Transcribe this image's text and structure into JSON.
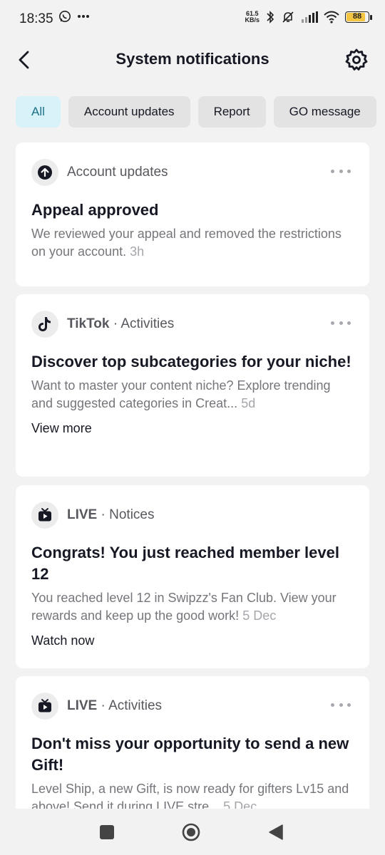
{
  "status_bar": {
    "time": "18:35",
    "net_speed_value": "61.5",
    "net_speed_unit": "KB/s",
    "battery": "88",
    "battery_level_percent": 88,
    "battery_color": "#f4c542",
    "icons": [
      "whatsapp-icon",
      "more-dots-icon",
      "bluetooth-icon",
      "mute-icon",
      "signal-icon",
      "wifi-icon",
      "battery-icon"
    ]
  },
  "header": {
    "title": "System notifications",
    "back_icon": "back-arrow-icon",
    "settings_icon": "gear-icon"
  },
  "filters": [
    {
      "label": "All",
      "active": true
    },
    {
      "label": "Account updates",
      "active": false
    },
    {
      "label": "Report",
      "active": false
    },
    {
      "label": "GO message",
      "active": false
    }
  ],
  "notifications": [
    {
      "icon": "upload-arrow-icon",
      "source": "Account updates",
      "category": "",
      "title": "Appeal approved",
      "body": "We reviewed your appeal and removed the restrictions on your account.",
      "time": "3h",
      "link": ""
    },
    {
      "icon": "tiktok-icon",
      "source": "TikTok",
      "category": "Activities",
      "title": "Discover top subcategories for your niche!",
      "body": "Want to master your content niche? Explore trending and suggested categories in Creat...",
      "time": "5d",
      "link": "View more"
    },
    {
      "icon": "live-tv-icon",
      "source": "LIVE",
      "category": "Notices",
      "title": "Congrats! You just reached member level 12",
      "body": "You reached level 12 in Swipzz's Fan Club. View your rewards and keep up the good work!",
      "time": "5 Dec",
      "link": "Watch now"
    },
    {
      "icon": "live-tv-icon",
      "source": "LIVE",
      "category": "Activities",
      "title": "Don't miss your opportunity to send a new Gift!",
      "body": "Level Ship, a new Gift, is now ready for gifters Lv15 and above! Send it during LIVE stre...",
      "time": "5 Dec",
      "link": ""
    }
  ],
  "colors": {
    "background": "#f2f2f2",
    "active_chip_bg": "#d7f2f9",
    "active_chip_text": "#1c6f86"
  }
}
